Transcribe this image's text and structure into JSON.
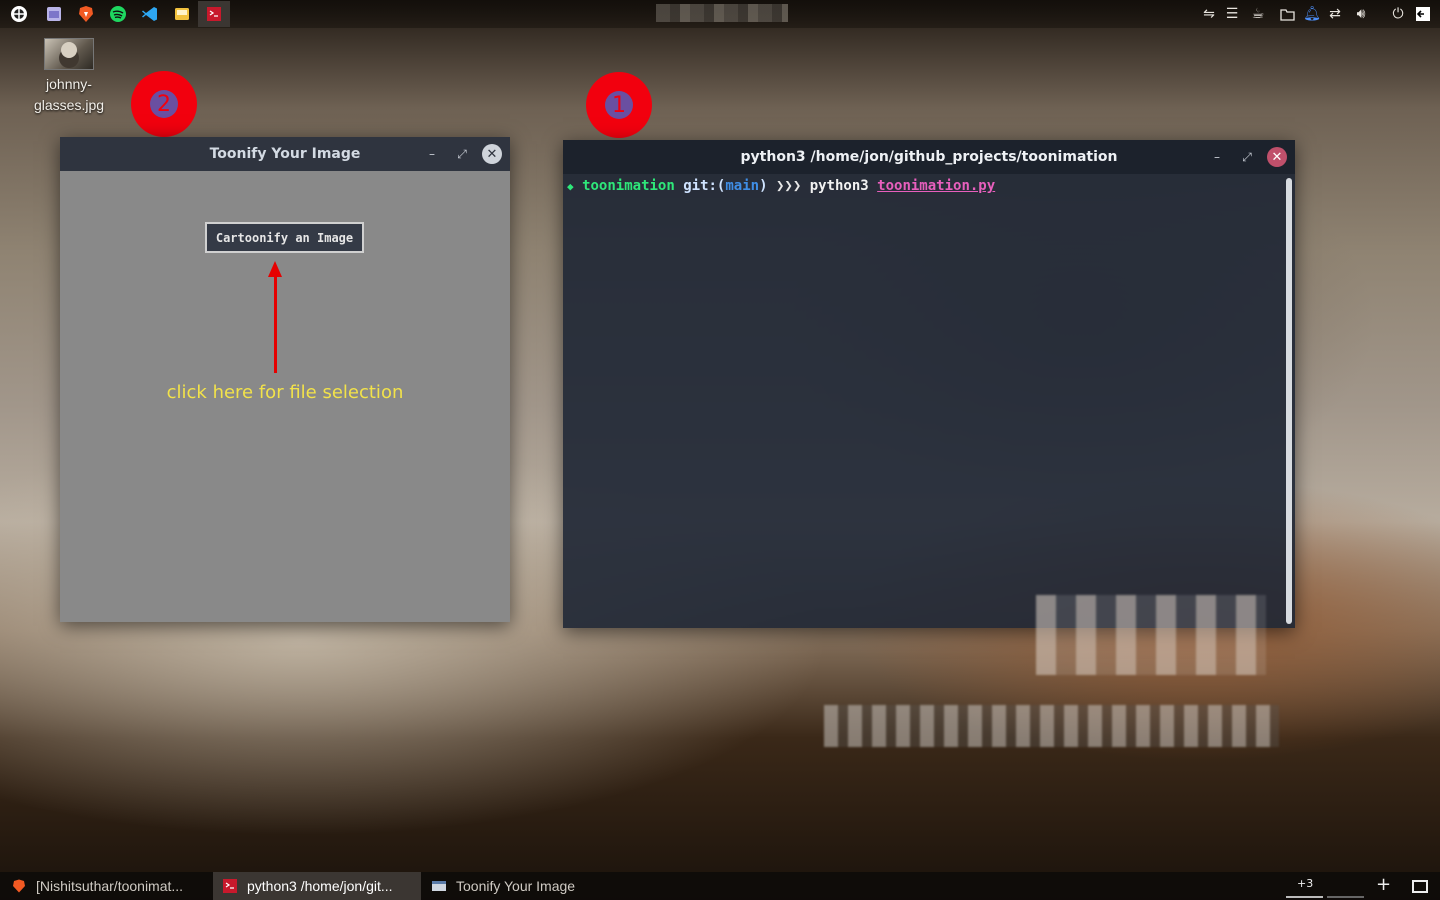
{
  "top_panel": {
    "launchers": [
      "globe-icon",
      "files-icon",
      "brave-icon",
      "spotify-icon",
      "vscode-icon",
      "mail-icon",
      "terminal-icon"
    ],
    "tray": [
      "network-icon",
      "menu-icon",
      "coffee-icon",
      "folder-icon",
      "notification-icon",
      "sync-icon",
      "volume-icon",
      "power-icon",
      "logout-icon"
    ]
  },
  "desktop": {
    "file_icon_label": "johnny-\nglasses.jpg"
  },
  "markers": [
    {
      "label": "2"
    },
    {
      "label": "1"
    }
  ],
  "toonify_window": {
    "title": "Toonify Your Image",
    "button_label": "Cartoonify an Image",
    "hint": "click here for file selection"
  },
  "terminal_window": {
    "title": "python3 /home/jon/github_projects/toonimation",
    "prompt": {
      "symbol": "◆",
      "dir": "toonimation",
      "git_prefix": "git:(",
      "branch": "main",
      "git_suffix": ")",
      "arrows": "❯❯❯",
      "command": "python3",
      "file": "toonimation.py"
    }
  },
  "taskbar": {
    "tasks": [
      {
        "label": "[Nishitsuthar/toonimat..."
      },
      {
        "label": "python3 /home/jon/git..."
      },
      {
        "label": "Toonify Your Image"
      }
    ],
    "workspace_label": "+3",
    "add_label": "+"
  },
  "colors": {
    "marker_red": "#f2000e",
    "prompt_green": "#2ee87a",
    "branch_blue": "#3f8ee6",
    "file_pink": "#e85fbd",
    "hint_yellow": "#f2e24a"
  }
}
